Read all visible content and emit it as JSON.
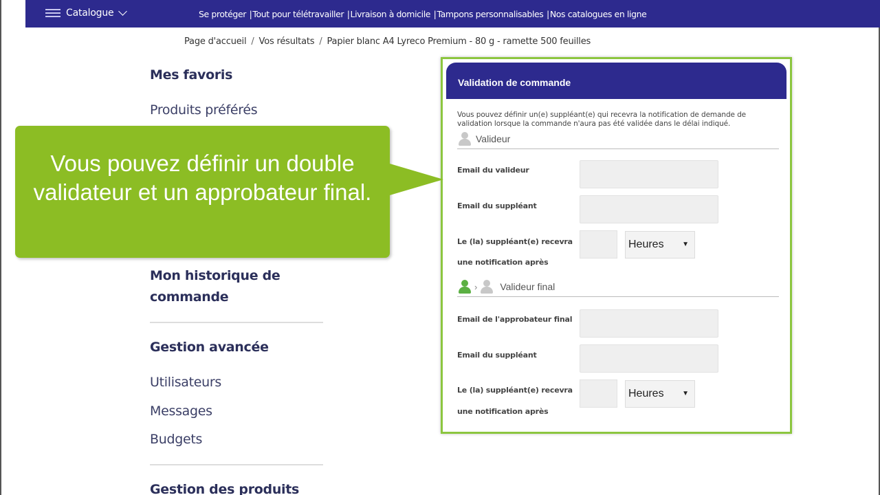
{
  "nav": {
    "catalogue": "Catalogue",
    "links": [
      "Se protéger",
      "Tout pour télétravailler",
      "Livraison à domicile",
      "Tampons personnalisables",
      "Nos catalogues en ligne"
    ]
  },
  "breadcrumb": [
    "Page d'accueil",
    "Vos résultats",
    "Papier blanc A4 Lyreco Premium - 80 g - ramette 500 feuilles"
  ],
  "sidebar": {
    "favorites_title": "Mes favoris",
    "favorites_link": "Produits préférés",
    "history_title": "Mon historique de commande",
    "advanced_title": "Gestion avancée",
    "advanced_links": [
      "Utilisateurs",
      "Messages",
      "Budgets"
    ],
    "products_title": "Gestion des produits"
  },
  "callout": {
    "text": "Vous pouvez définir un double validateur et un approbateur final.",
    "color": "#8cbd24"
  },
  "panel": {
    "title": "Validation de commande",
    "description": "Vous pouvez définir un(e) suppléant(e) qui recevra la notification de demande de validation lorsque la commande n'aura pas été validée dans le délai indiqué.",
    "section1": {
      "title": "Valideur",
      "label_email": "Email du valideur",
      "label_substitute": "Email du suppléant",
      "label_notify_1": "Le (la) suppléant(e) recevra",
      "label_notify_2": "une notification après",
      "unit": "Heures"
    },
    "section2": {
      "title": "Valideur final",
      "label_email": "Email de l'approbateur final",
      "label_substitute": "Email du suppléant",
      "label_notify_1": "Le (la) suppléant(e) recevra",
      "label_notify_2": "une notification après",
      "unit": "Heures"
    },
    "accent_color": "#2d2a8e",
    "border_color": "#8cc63f"
  }
}
